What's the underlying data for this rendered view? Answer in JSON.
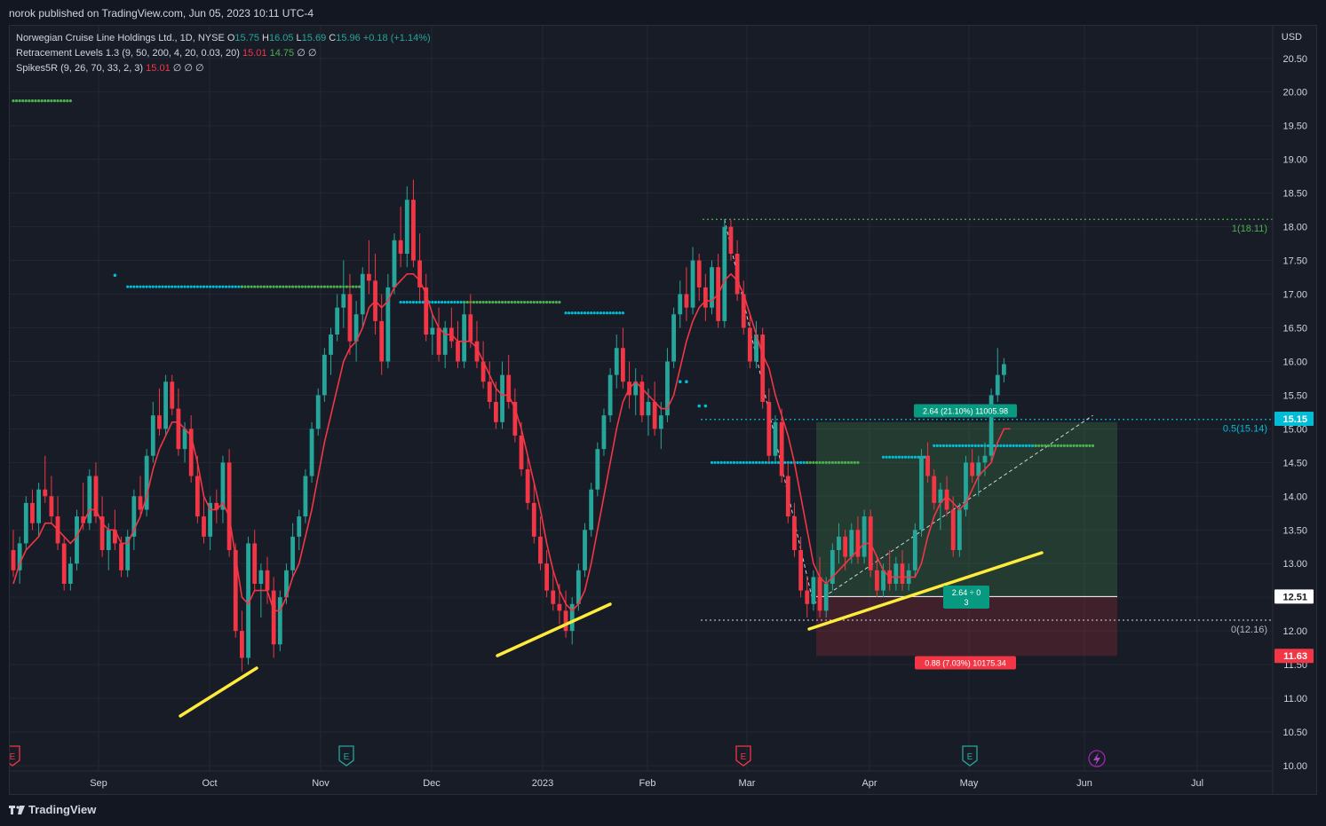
{
  "header": {
    "published": "norok published on TradingView.com, Jun 05, 2023 10:11 UTC-4"
  },
  "legend": {
    "symbol": "Norwegian Cruise Line Holdings Ltd., 1D, NYSE",
    "o_label": "O",
    "o": "15.75",
    "h_label": "H",
    "h": "16.05",
    "l_label": "L",
    "l": "15.69",
    "c_label": "C",
    "c": "15.96",
    "change": "+0.18 (+1.14%)",
    "indicator1": "Retracement Levels 1.3 (9, 50, 200, 4, 20, 0.03, 20)",
    "indicator1_v1": "15.01",
    "indicator1_v2": "14.75",
    "indicator1_rest": "∅ ∅",
    "indicator2": "Spikes5R (9, 26, 70, 33, 2, 3)",
    "indicator2_v1": "15.01",
    "indicator2_rest": "∅ ∅ ∅"
  },
  "footer": {
    "brand": "TradingView"
  },
  "colors": {
    "up": "#26a69a",
    "down": "#f23645",
    "bg": "#181c27",
    "ma": "#f23645",
    "trend": "#ffeb3b"
  },
  "chart_data": {
    "type": "candlestick",
    "currency": "USD",
    "ylim": [
      10.0,
      20.8
    ],
    "y_ticks": [
      10.0,
      10.5,
      11.0,
      11.5,
      12.0,
      12.5,
      13.0,
      13.5,
      14.0,
      14.5,
      15.0,
      15.5,
      16.0,
      16.5,
      17.0,
      17.5,
      18.0,
      18.5,
      19.0,
      19.5,
      20.0,
      20.5
    ],
    "x_ticks": [
      "Sep",
      "Oct",
      "Nov",
      "Dec",
      "2023",
      "Feb",
      "Mar",
      "Apr",
      "May",
      "Jun",
      "Jul"
    ],
    "price_axis_labels": [
      {
        "value": 15.15,
        "text": "15.15",
        "color": "#00bcd4"
      },
      {
        "value": 12.51,
        "text": "12.51",
        "color": "#ffffff"
      },
      {
        "value": 11.63,
        "text": "11.63",
        "color": "#f23645"
      }
    ],
    "fib_levels": [
      {
        "value": 18.11,
        "label": "1(18.11)",
        "color": "#4caf50"
      },
      {
        "value": 15.14,
        "label": "0.5(15.14)",
        "color": "#00bcd4"
      },
      {
        "value": 12.16,
        "label": "0(12.16)",
        "color": "#b2b5be"
      }
    ],
    "position": {
      "entry": 12.51,
      "target": 15.1,
      "stop": 11.63,
      "profit_label": "2.64 (21.10%) 11005.98",
      "loss_label": "0.88 (7.03%) 10175.34",
      "ratio_label": "2.64 ÷ 0",
      "ratio_sub": "3"
    },
    "earnings_markers": [
      "E",
      "E",
      "E",
      "E"
    ],
    "candles": [
      [
        13.2,
        13.5,
        12.8,
        12.9
      ],
      [
        12.9,
        13.4,
        12.7,
        13.3
      ],
      [
        13.3,
        14.0,
        13.2,
        13.9
      ],
      [
        13.9,
        14.1,
        13.5,
        13.6
      ],
      [
        13.6,
        14.2,
        13.4,
        14.1
      ],
      [
        14.1,
        14.6,
        13.9,
        14.0
      ],
      [
        14.0,
        14.3,
        13.6,
        13.7
      ],
      [
        13.7,
        14.0,
        13.2,
        13.3
      ],
      [
        13.3,
        13.4,
        12.6,
        12.7
      ],
      [
        12.7,
        13.1,
        12.6,
        13.0
      ],
      [
        13.0,
        13.8,
        12.9,
        13.7
      ],
      [
        13.7,
        14.2,
        13.5,
        13.6
      ],
      [
        13.6,
        14.4,
        13.5,
        14.3
      ],
      [
        14.3,
        14.5,
        13.6,
        13.7
      ],
      [
        13.7,
        14.0,
        13.1,
        13.2
      ],
      [
        13.2,
        13.6,
        12.9,
        13.5
      ],
      [
        13.5,
        13.8,
        13.2,
        13.3
      ],
      [
        13.3,
        13.4,
        12.8,
        12.9
      ],
      [
        12.9,
        13.5,
        12.8,
        13.4
      ],
      [
        13.4,
        14.1,
        13.2,
        14.0
      ],
      [
        14.0,
        14.3,
        13.7,
        13.8
      ],
      [
        13.8,
        14.7,
        13.7,
        14.6
      ],
      [
        14.6,
        15.4,
        14.5,
        15.2
      ],
      [
        15.2,
        15.6,
        14.9,
        15.0
      ],
      [
        15.0,
        15.8,
        14.9,
        15.7
      ],
      [
        15.7,
        15.8,
        15.2,
        15.3
      ],
      [
        15.3,
        15.6,
        14.6,
        14.7
      ],
      [
        14.7,
        15.1,
        14.5,
        15.0
      ],
      [
        15.0,
        15.2,
        14.2,
        14.3
      ],
      [
        14.3,
        14.6,
        13.6,
        13.7
      ],
      [
        13.7,
        14.0,
        13.3,
        13.4
      ],
      [
        13.4,
        14.0,
        13.2,
        13.9
      ],
      [
        13.9,
        14.1,
        13.6,
        13.8
      ],
      [
        13.8,
        14.6,
        13.6,
        14.5
      ],
      [
        14.5,
        14.7,
        13.1,
        13.2
      ],
      [
        13.2,
        13.3,
        11.9,
        12.0
      ],
      [
        12.0,
        12.3,
        11.4,
        11.6
      ],
      [
        11.6,
        13.4,
        11.5,
        13.3
      ],
      [
        13.3,
        13.5,
        12.6,
        12.7
      ],
      [
        12.7,
        13.0,
        12.2,
        12.9
      ],
      [
        12.9,
        13.1,
        12.4,
        12.6
      ],
      [
        12.6,
        12.8,
        11.6,
        11.8
      ],
      [
        11.8,
        12.6,
        11.7,
        12.5
      ],
      [
        12.5,
        13.0,
        12.4,
        12.9
      ],
      [
        12.9,
        13.6,
        12.8,
        13.4
      ],
      [
        13.4,
        13.8,
        13.2,
        13.7
      ],
      [
        13.7,
        14.4,
        13.6,
        14.3
      ],
      [
        14.3,
        15.1,
        14.2,
        15.0
      ],
      [
        15.0,
        15.6,
        14.9,
        15.5
      ],
      [
        15.5,
        16.2,
        15.4,
        16.1
      ],
      [
        16.1,
        16.5,
        15.8,
        16.4
      ],
      [
        16.4,
        17.0,
        16.3,
        16.8
      ],
      [
        16.8,
        17.5,
        16.5,
        17.0
      ],
      [
        17.0,
        17.3,
        16.1,
        16.3
      ],
      [
        16.3,
        16.9,
        16.0,
        16.7
      ],
      [
        16.7,
        17.4,
        16.5,
        17.3
      ],
      [
        17.3,
        17.8,
        17.0,
        17.2
      ],
      [
        17.2,
        17.6,
        16.4,
        16.6
      ],
      [
        16.6,
        17.0,
        15.8,
        16.0
      ],
      [
        16.0,
        17.3,
        15.9,
        17.1
      ],
      [
        17.1,
        17.9,
        17.0,
        17.8
      ],
      [
        17.8,
        18.3,
        17.4,
        17.6
      ],
      [
        17.6,
        18.6,
        17.4,
        18.4
      ],
      [
        18.4,
        18.7,
        17.4,
        17.5
      ],
      [
        17.5,
        17.9,
        16.9,
        17.1
      ],
      [
        17.1,
        17.3,
        16.3,
        16.4
      ],
      [
        16.4,
        16.7,
        16.1,
        16.5
      ],
      [
        16.5,
        16.8,
        16.0,
        16.1
      ],
      [
        16.1,
        16.6,
        15.9,
        16.5
      ],
      [
        16.5,
        16.8,
        16.2,
        16.3
      ],
      [
        16.3,
        16.6,
        15.9,
        16.0
      ],
      [
        16.0,
        16.9,
        15.9,
        16.7
      ],
      [
        16.7,
        17.0,
        16.2,
        16.3
      ],
      [
        16.3,
        16.6,
        15.9,
        16.0
      ],
      [
        16.0,
        16.3,
        15.6,
        15.7
      ],
      [
        15.7,
        16.0,
        15.3,
        15.4
      ],
      [
        15.4,
        15.7,
        15.0,
        15.1
      ],
      [
        15.1,
        16.0,
        15.0,
        15.8
      ],
      [
        15.8,
        16.1,
        15.3,
        15.4
      ],
      [
        15.4,
        15.6,
        14.8,
        14.9
      ],
      [
        14.9,
        15.1,
        14.3,
        14.4
      ],
      [
        14.4,
        14.6,
        13.8,
        13.9
      ],
      [
        13.9,
        14.2,
        13.3,
        13.4
      ],
      [
        13.4,
        13.7,
        12.9,
        13.0
      ],
      [
        13.0,
        13.2,
        12.5,
        12.6
      ],
      [
        12.6,
        12.9,
        12.3,
        12.4
      ],
      [
        12.4,
        12.7,
        12.1,
        12.3
      ],
      [
        12.3,
        12.6,
        11.9,
        12.0
      ],
      [
        12.0,
        12.5,
        11.8,
        12.4
      ],
      [
        12.4,
        13.0,
        12.3,
        12.9
      ],
      [
        12.9,
        13.6,
        12.8,
        13.5
      ],
      [
        13.5,
        14.2,
        13.4,
        14.1
      ],
      [
        14.1,
        14.8,
        14.0,
        14.7
      ],
      [
        14.7,
        15.3,
        14.6,
        15.2
      ],
      [
        15.2,
        15.9,
        15.1,
        15.8
      ],
      [
        15.8,
        16.4,
        15.6,
        16.2
      ],
      [
        16.2,
        16.5,
        15.6,
        15.7
      ],
      [
        15.7,
        16.0,
        15.3,
        15.5
      ],
      [
        15.5,
        15.9,
        15.2,
        15.7
      ],
      [
        15.7,
        15.8,
        15.1,
        15.2
      ],
      [
        15.2,
        15.6,
        14.9,
        15.4
      ],
      [
        15.4,
        15.7,
        14.9,
        15.0
      ],
      [
        15.0,
        15.4,
        14.7,
        15.2
      ],
      [
        15.2,
        16.2,
        15.1,
        16.0
      ],
      [
        16.0,
        16.8,
        15.9,
        16.7
      ],
      [
        16.7,
        17.2,
        16.5,
        17.0
      ],
      [
        17.0,
        17.4,
        16.6,
        16.8
      ],
      [
        16.8,
        17.7,
        16.7,
        17.5
      ],
      [
        17.5,
        17.6,
        16.9,
        17.1
      ],
      [
        17.1,
        17.3,
        16.6,
        16.8
      ],
      [
        16.8,
        17.5,
        16.7,
        17.4
      ],
      [
        17.4,
        17.6,
        16.5,
        16.6
      ],
      [
        16.6,
        18.1,
        16.5,
        18.0
      ],
      [
        18.0,
        18.1,
        17.5,
        17.6
      ],
      [
        17.6,
        17.8,
        16.9,
        17.0
      ],
      [
        17.0,
        17.2,
        16.4,
        16.5
      ],
      [
        16.5,
        16.7,
        15.9,
        16.0
      ],
      [
        16.0,
        16.6,
        15.9,
        16.4
      ],
      [
        16.4,
        16.5,
        15.3,
        15.4
      ],
      [
        15.4,
        15.6,
        14.5,
        14.6
      ],
      [
        14.6,
        15.2,
        14.5,
        15.1
      ],
      [
        15.1,
        15.3,
        14.2,
        14.3
      ],
      [
        14.3,
        14.5,
        13.6,
        13.7
      ],
      [
        13.7,
        13.9,
        13.1,
        13.2
      ],
      [
        13.2,
        13.4,
        12.5,
        12.6
      ],
      [
        12.6,
        12.8,
        12.2,
        12.4
      ],
      [
        12.4,
        12.9,
        12.3,
        12.8
      ],
      [
        12.8,
        13.1,
        12.2,
        12.3
      ],
      [
        12.3,
        12.8,
        12.2,
        12.7
      ],
      [
        12.7,
        13.3,
        12.6,
        13.2
      ],
      [
        13.2,
        13.6,
        13.0,
        13.4
      ],
      [
        13.4,
        13.5,
        12.9,
        13.1
      ],
      [
        13.1,
        13.6,
        13.0,
        13.5
      ],
      [
        13.5,
        13.7,
        13.0,
        13.1
      ],
      [
        13.1,
        13.8,
        13.0,
        13.7
      ],
      [
        13.7,
        13.8,
        12.8,
        12.9
      ],
      [
        12.9,
        13.1,
        12.5,
        12.6
      ],
      [
        12.6,
        13.0,
        12.5,
        12.9
      ],
      [
        12.9,
        13.2,
        12.6,
        12.7
      ],
      [
        12.7,
        13.1,
        12.6,
        13.0
      ],
      [
        13.0,
        13.2,
        12.6,
        12.7
      ],
      [
        12.7,
        13.0,
        12.6,
        12.9
      ],
      [
        12.9,
        13.6,
        12.8,
        13.5
      ],
      [
        13.5,
        14.7,
        13.4,
        14.6
      ],
      [
        14.6,
        14.8,
        14.2,
        14.3
      ],
      [
        14.3,
        14.4,
        13.8,
        13.9
      ],
      [
        13.9,
        14.2,
        13.5,
        14.1
      ],
      [
        14.1,
        14.3,
        13.7,
        13.8
      ],
      [
        13.8,
        14.0,
        13.1,
        13.2
      ],
      [
        13.2,
        13.9,
        13.1,
        13.8
      ],
      [
        13.8,
        14.6,
        13.7,
        14.5
      ],
      [
        14.5,
        14.7,
        14.2,
        14.3
      ],
      [
        14.3,
        14.6,
        14.0,
        14.5
      ],
      [
        14.5,
        14.8,
        14.3,
        14.6
      ],
      [
        14.6,
        15.6,
        14.5,
        15.5
      ],
      [
        15.5,
        16.2,
        15.4,
        15.8
      ],
      [
        15.8,
        16.05,
        15.69,
        15.96
      ]
    ],
    "ma_line": [
      12.7,
      13.0,
      13.2,
      13.3,
      13.4,
      13.6,
      13.6,
      13.5,
      13.4,
      13.3,
      13.4,
      13.6,
      13.8,
      13.8,
      13.6,
      13.5,
      13.5,
      13.3,
      13.3,
      13.5,
      13.7,
      14.0,
      14.4,
      14.7,
      14.9,
      15.1,
      15.1,
      15.0,
      14.9,
      14.5,
      14.0,
      13.8,
      13.8,
      13.9,
      13.7,
      13.1,
      12.5,
      12.4,
      12.6,
      12.6,
      12.6,
      12.3,
      12.3,
      12.5,
      12.8,
      13.0,
      13.4,
      13.8,
      14.3,
      14.8,
      15.2,
      15.6,
      16.0,
      16.2,
      16.3,
      16.5,
      16.8,
      16.9,
      16.8,
      16.9,
      17.1,
      17.2,
      17.3,
      17.3,
      17.2,
      17.0,
      16.7,
      16.5,
      16.4,
      16.4,
      16.3,
      16.3,
      16.3,
      16.2,
      16.0,
      15.8,
      15.6,
      15.5,
      15.5,
      15.3,
      15.0,
      14.6,
      14.2,
      13.8,
      13.3,
      12.9,
      12.6,
      12.4,
      12.3,
      12.4,
      12.6,
      13.0,
      13.5,
      14.0,
      14.5,
      15.0,
      15.4,
      15.6,
      15.7,
      15.6,
      15.5,
      15.4,
      15.3,
      15.3,
      15.5,
      15.9,
      16.3,
      16.6,
      16.8,
      16.9,
      16.9,
      17.0,
      17.2,
      17.3,
      17.2,
      17.0,
      16.7,
      16.4,
      16.1,
      15.9,
      15.5,
      15.2,
      14.9,
      14.5,
      14.0,
      13.5,
      13.0,
      12.8,
      12.7,
      12.8,
      12.9,
      13.0,
      13.1,
      13.2,
      13.3,
      13.3,
      13.1,
      12.9,
      12.8,
      12.8,
      12.8,
      12.8,
      12.8,
      13.0,
      13.4,
      13.7,
      13.9,
      14.0,
      13.9,
      13.8,
      13.9,
      14.1,
      14.3,
      14.4,
      14.5,
      14.8,
      15.0,
      15.0
    ],
    "spike_dots": [
      {
        "x0": 0,
        "x1": 9,
        "y": 19.87,
        "color": "#4caf50"
      },
      {
        "x0": 18,
        "x1": 36,
        "y": 17.11,
        "color": "#00bcd4"
      },
      {
        "x0": 36,
        "x1": 55,
        "y": 17.11,
        "color": "#4caf50"
      },
      {
        "x0": 61,
        "x1": 71,
        "y": 16.88,
        "color": "#00bcd4"
      },
      {
        "x0": 71,
        "x1": 86,
        "y": 16.88,
        "color": "#4caf50"
      },
      {
        "x0": 87,
        "x1": 96,
        "y": 16.72,
        "color": "#00bcd4"
      },
      {
        "x0": 110,
        "x1": 125,
        "y": 14.5,
        "color": "#00bcd4"
      },
      {
        "x0": 125,
        "x1": 133,
        "y": 14.5,
        "color": "#4caf50"
      },
      {
        "x0": 137,
        "x1": 144,
        "y": 14.58,
        "color": "#00bcd4"
      },
      {
        "x0": 145,
        "x1": 161,
        "y": 14.75,
        "color": "#00bcd4"
      },
      {
        "x0": 161,
        "x1": 170,
        "y": 14.75,
        "color": "#4caf50"
      }
    ]
  }
}
